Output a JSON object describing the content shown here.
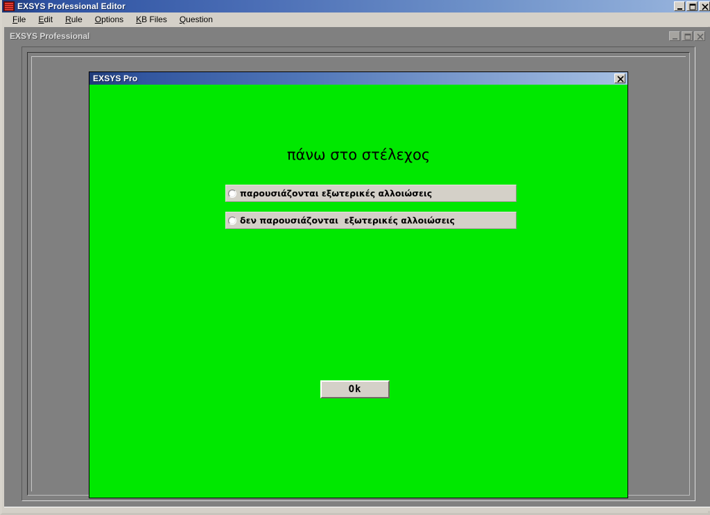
{
  "main_window": {
    "title": "EXSYS Professional Editor",
    "icon": "exsys-app-icon",
    "controls": {
      "minimize": "minimize-icon",
      "maximize": "maximize-icon",
      "close": "close-icon"
    },
    "menu": [
      {
        "label": "File",
        "accel": "F"
      },
      {
        "label": "Edit",
        "accel": "E"
      },
      {
        "label": "Rule",
        "accel": "R"
      },
      {
        "label": "Options",
        "accel": "O"
      },
      {
        "label": "KB Files",
        "accel": "K"
      },
      {
        "label": "Question",
        "accel": "Q"
      }
    ]
  },
  "child_window": {
    "title": "EXSYS Professional",
    "active": false,
    "controls": {
      "minimize": "minimize-icon",
      "maximize": "maximize-icon",
      "close": "close-icon"
    }
  },
  "dialog": {
    "title": "EXSYS Pro",
    "close_label": "close-icon",
    "background_color": "#00e800",
    "question": "πάνω στο στέλεχος",
    "options": [
      {
        "label": "παρουσιάζονται εξωτερικές αλλοιώσεις",
        "selected": false
      },
      {
        "label": "δεν παρουσιάζονται  εξωτερικές αλλοιώσεις",
        "selected": false
      }
    ],
    "ok_label": "Ok"
  },
  "colors": {
    "face": "#d4d0c8",
    "workspace": "#808080",
    "title_active_start": "#1f3a78",
    "title_active_end": "#a6c0e3",
    "dialog_green": "#00e800"
  }
}
